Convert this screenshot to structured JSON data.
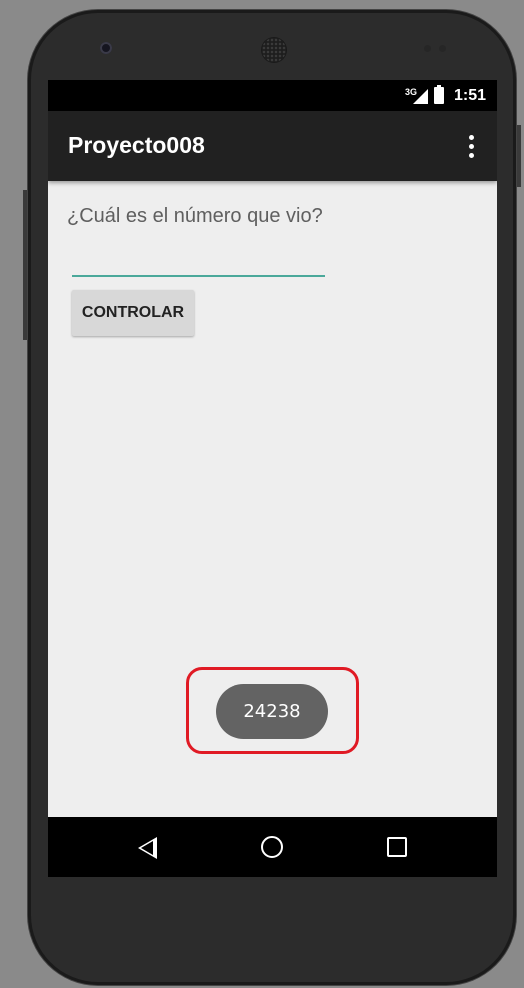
{
  "status_bar": {
    "network": "3G",
    "time": "1:51"
  },
  "app_bar": {
    "title": "Proyecto008",
    "overflow_icon": "more-vert-icon"
  },
  "main": {
    "question": "¿Cuál es el número que vio?",
    "answer_input": {
      "value": "",
      "placeholder": ""
    },
    "controlar_label": "CONTROLAR"
  },
  "toast": {
    "text": "24238"
  },
  "nav_bar": {
    "back_icon": "back-icon",
    "home_icon": "home-icon",
    "recents_icon": "recents-icon"
  },
  "colors": {
    "accent": "#4aa89a",
    "highlight": "#e01a24",
    "app_bar": "#212121",
    "background": "#eeeeee"
  }
}
